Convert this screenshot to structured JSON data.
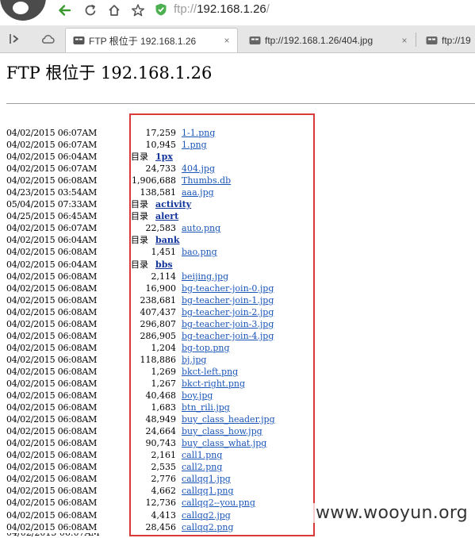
{
  "address_bar": {
    "url_scheme": "ftp://",
    "url_host": "192.168.1.26",
    "url_rest": "/",
    "icons": [
      "browser-logo-icon",
      "back-arrow-icon",
      "refresh-icon",
      "home-icon",
      "star-icon",
      "shield-icon"
    ]
  },
  "tabs": [
    {
      "label": "FTP 根位于 192.168.1.26",
      "active": true,
      "close": "×"
    },
    {
      "label": "ftp://192.168.1.26/404.jpg",
      "active": false,
      "close": "×"
    },
    {
      "label": "ftp://19",
      "active": false,
      "close": ""
    }
  ],
  "page": {
    "heading": "FTP 根位于 192.168.1.26",
    "dir_label": "目录",
    "entries": [
      {
        "date": "04/02/2015 06:07AM",
        "size": "17,259",
        "name": "1-1.png",
        "dir": false
      },
      {
        "date": "04/02/2015 06:07AM",
        "size": "10,945",
        "name": "1.png",
        "dir": false
      },
      {
        "date": "04/02/2015 06:04AM",
        "size": "",
        "name": "1px",
        "dir": true
      },
      {
        "date": "04/02/2015 06:07AM",
        "size": "24,733",
        "name": "404.jpg",
        "dir": false
      },
      {
        "date": "04/02/2015 06:08AM",
        "size": "1,906,688",
        "name": "Thumbs.db",
        "dir": false
      },
      {
        "date": "04/23/2015 03:54AM",
        "size": "138,581",
        "name": "aaa.jpg",
        "dir": false
      },
      {
        "date": "05/04/2015 07:33AM",
        "size": "",
        "name": "activity",
        "dir": true
      },
      {
        "date": "04/25/2015 06:45AM",
        "size": "",
        "name": "alert",
        "dir": true
      },
      {
        "date": "04/02/2015 06:07AM",
        "size": "22,583",
        "name": "auto.png",
        "dir": false
      },
      {
        "date": "04/02/2015 06:04AM",
        "size": "",
        "name": "bank",
        "dir": true
      },
      {
        "date": "04/02/2015 06:08AM",
        "size": "1,451",
        "name": "bao.png",
        "dir": false
      },
      {
        "date": "04/02/2015 06:04AM",
        "size": "",
        "name": "bbs",
        "dir": true
      },
      {
        "date": "04/02/2015 06:08AM",
        "size": "2,114",
        "name": "beijing.jpg",
        "dir": false
      },
      {
        "date": "04/02/2015 06:08AM",
        "size": "16,900",
        "name": "bg-teacher-join-0.jpg",
        "dir": false
      },
      {
        "date": "04/02/2015 06:08AM",
        "size": "238,681",
        "name": "bg-teacher-join-1.jpg",
        "dir": false
      },
      {
        "date": "04/02/2015 06:08AM",
        "size": "407,437",
        "name": "bg-teacher-join-2.jpg",
        "dir": false
      },
      {
        "date": "04/02/2015 06:08AM",
        "size": "296,807",
        "name": "bg-teacher-join-3.jpg",
        "dir": false
      },
      {
        "date": "04/02/2015 06:08AM",
        "size": "286,905",
        "name": "bg-teacher-join-4.jpg",
        "dir": false
      },
      {
        "date": "04/02/2015 06:08AM",
        "size": "1,204",
        "name": "bg-top.png",
        "dir": false
      },
      {
        "date": "04/02/2015 06:08AM",
        "size": "118,886",
        "name": "bj.jpg",
        "dir": false
      },
      {
        "date": "04/02/2015 06:08AM",
        "size": "1,269",
        "name": "bkct-left.png",
        "dir": false
      },
      {
        "date": "04/02/2015 06:08AM",
        "size": "1,267",
        "name": "bkct-right.png",
        "dir": false
      },
      {
        "date": "04/02/2015 06:08AM",
        "size": "40,468",
        "name": "boy.jpg",
        "dir": false
      },
      {
        "date": "04/02/2015 06:08AM",
        "size": "1,683",
        "name": "btn_rili.jpg",
        "dir": false
      },
      {
        "date": "04/02/2015 06:08AM",
        "size": "48,949",
        "name": "buy_class_header.jpg",
        "dir": false
      },
      {
        "date": "04/02/2015 06:08AM",
        "size": "24,664",
        "name": "buy_class_how.jpg",
        "dir": false
      },
      {
        "date": "04/02/2015 06:08AM",
        "size": "90,743",
        "name": "buy_class_what.jpg",
        "dir": false
      },
      {
        "date": "04/02/2015 06:08AM",
        "size": "2,161",
        "name": "call1.png",
        "dir": false
      },
      {
        "date": "04/02/2015 06:08AM",
        "size": "2,535",
        "name": "call2.png",
        "dir": false
      },
      {
        "date": "04/02/2015 06:08AM",
        "size": "2,776",
        "name": "callqq1.jpg",
        "dir": false
      },
      {
        "date": "04/02/2015 06:08AM",
        "size": "4,662",
        "name": "callqq1.png",
        "dir": false
      },
      {
        "date": "04/02/2015 06:08AM",
        "size": "12,736",
        "name": "callqq2--you.png",
        "dir": false
      },
      {
        "date": "04/02/2015 06:08AM",
        "size": "4,413",
        "name": "callqq2.jpg",
        "dir": false
      },
      {
        "date": "04/02/2015 06:08AM",
        "size": "28,456",
        "name": "callqq2.png",
        "dir": false
      }
    ]
  },
  "watermark": "www.wooyun.org",
  "colors": {
    "back_arrow": "#3a9a2e",
    "shield": "#4caf50",
    "link": "#1a55b8",
    "highlight": "#d83a3a"
  }
}
